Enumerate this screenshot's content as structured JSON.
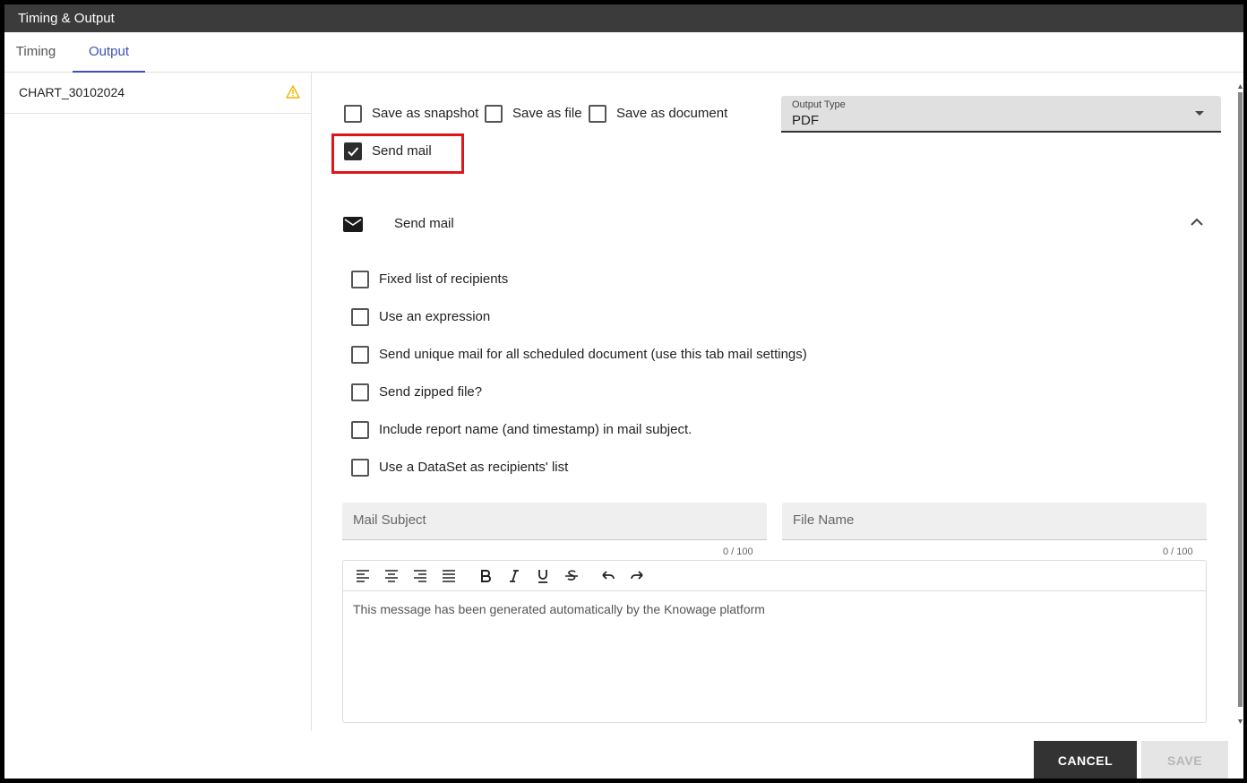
{
  "window": {
    "title": "Timing & Output"
  },
  "tabs": [
    {
      "label": "Timing",
      "active": false
    },
    {
      "label": "Output",
      "active": true
    }
  ],
  "documents": [
    {
      "name": "CHART_30102024",
      "status_icon": "warning-icon"
    }
  ],
  "output_options": {
    "save_snapshot": {
      "label": "Save as snapshot",
      "checked": false
    },
    "save_file": {
      "label": "Save as file",
      "checked": false
    },
    "save_document": {
      "label": "Save as document",
      "checked": false
    },
    "send_mail": {
      "label": "Send mail",
      "checked": true
    }
  },
  "output_type": {
    "label": "Output Type",
    "value": "PDF"
  },
  "mail_section": {
    "title": "Send mail",
    "icon": "envelope-icon",
    "options": [
      {
        "label": "Fixed list of recipients",
        "checked": false
      },
      {
        "label": "Use an expression",
        "checked": false
      },
      {
        "label": "Send unique mail for all scheduled document (use this tab mail settings)",
        "checked": false
      },
      {
        "label": "Send zipped file?",
        "checked": false
      },
      {
        "label": "Include report name (and timestamp) in mail subject.",
        "checked": false
      },
      {
        "label": "Use a DataSet as recipients' list",
        "checked": false
      }
    ],
    "mail_subject": {
      "placeholder": "Mail Subject",
      "counter": "0 / 100"
    },
    "file_name": {
      "placeholder": "File Name",
      "counter": "0 / 100"
    },
    "message": "This message has been generated automatically by the Knowage platform"
  },
  "buttons": {
    "cancel": "CANCEL",
    "save": "SAVE"
  },
  "colors": {
    "accent": "#3f51b5",
    "highlight": "#e0151b",
    "titlebar": "#3b3b3b",
    "warning": "#f4b400"
  }
}
